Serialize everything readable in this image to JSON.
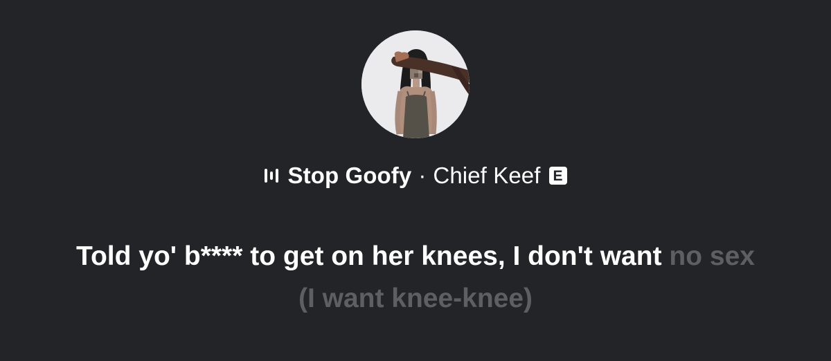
{
  "now_playing": {
    "title": "Stop Goofy",
    "separator": "·",
    "artist": "Chief Keef",
    "explicit_badge": "E",
    "icon": "waveform-icon"
  },
  "lyrics": {
    "sung": "Told yo' b**** to get on her knees, I don't want",
    "upcoming": "no sex (I want knee-knee)"
  },
  "colors": {
    "background": "#232428",
    "text": "#ffffff",
    "upcoming_text": "#5e5f64"
  }
}
